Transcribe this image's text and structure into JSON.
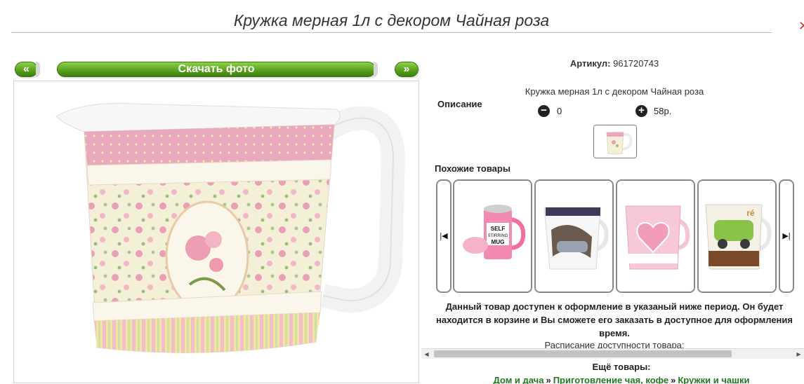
{
  "page": {
    "title": "Кружка мерная 1л с декором Чайная роза"
  },
  "gallery": {
    "prev_label": "«",
    "download_label": "Скачать фото",
    "next_label": "»"
  },
  "product": {
    "article_label": "Артикул:",
    "article_value": "961720743",
    "description_label": "Описание",
    "description_text": "Кружка мерная 1л с декором Чайная роза",
    "quantity": "0",
    "price": "58р."
  },
  "similar": {
    "label": "Похожие товары",
    "items": [
      {
        "name": "self-stirring-mug"
      },
      {
        "name": "car-print-mug"
      },
      {
        "name": "pink-heart-mug"
      },
      {
        "name": "retro-car-mug"
      }
    ]
  },
  "notice": {
    "text": "Данный товар доступен к оформление в указаный ниже период. Он будет находится в корзине и Вы сможете его заказать в доступное для оформления время.",
    "schedule": "Расписание доступности товара:"
  },
  "more": {
    "label": "Ещё товары:",
    "crumbs": [
      "Дом и дача",
      "Приготовление чая, кофе",
      "Кружки и чашки"
    ],
    "separator": "»"
  },
  "colors": {
    "button_green": "#5aa21f",
    "link_green": "#1f7a1f",
    "accent_pink": "#e9a9bd"
  }
}
